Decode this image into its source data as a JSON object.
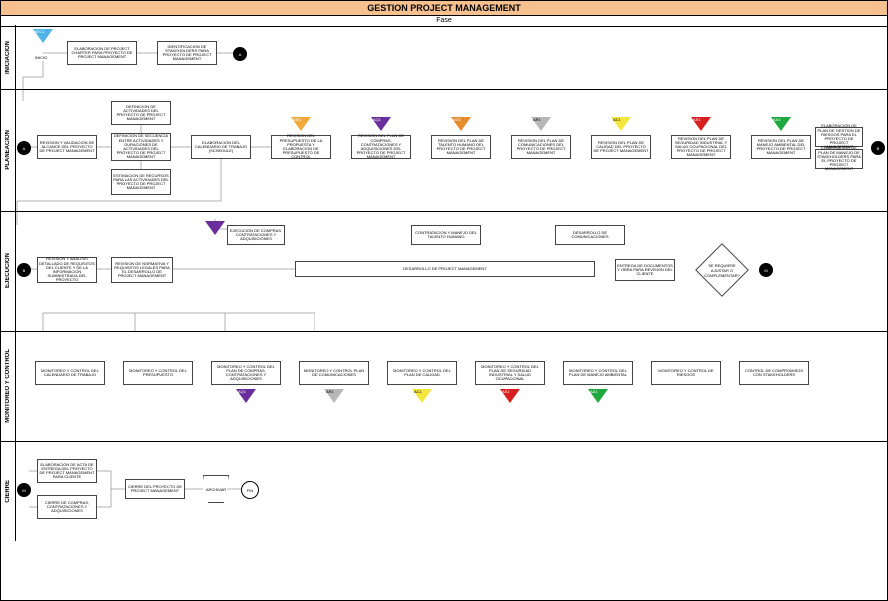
{
  "title": "GESTION PROJECT MANAGEMENT",
  "subtitle": "Fase",
  "lanes": {
    "iniciacion": "INICIACION",
    "planeacion": "PLANEACION",
    "ejecucion": "EJECUCION",
    "monitoreo": "MONITOREO Y CONTROL",
    "cierre": "CIERRE"
  },
  "nodes": {
    "inicio_label": "INICIO",
    "inicio_sig": "AEC1",
    "i1": "ELABORACION DE PROJECT CHARTER PARA PROYECTO DE PROJECT MANAGEMENT",
    "i2": "IDENTIFICACION DE STAKEHOLDERS PARA PROYECTO DE PROJECT MANAGEMENT",
    "ref_A": "A",
    "p1": "REVISION Y VALIDACION DE ALCANCE DEL PROYECTO DE PROJECT MANAGEMENT",
    "p2": "DEFINICION DE ACTIVIDADES DEL PROYECTO DE PROJECT MANAGEMENT",
    "p3": "DEFINICION DE SECUENCIA ENTRE ACTIVIDADES Y DURACIONES DE ACTIVIDADES DEL PROYECTO DE PROJECT MANAGEMENT",
    "p4": "ESTIMACION DE RECURSOS PARA LAS ACTIVIDADES DEL PROYECTO DE PROJECT MANAGEMENT",
    "p5": "ELABORACION DEL CALENDARIO DE TRABAJO (SCHEDULE)",
    "p6": "REVISION DEL PRESUPUESTO DE LA PROPUESTA Y ELABORACION DE PRESUPUESTO DE CONTROL",
    "p7": "REVISION DEL PLAN DE COMPRAS, CONTRATACIONES Y ADQUISICIONES DEL PROYECTO DE PROJECT MANAGEMENT",
    "p8": "REVISION DEL PLAN DE TALENTO HUMANO DEL PROYECTO DE PROJECT MANAGEMENT",
    "p9": "REVISION DEL PLAN DE COMUNICACIONES DEL PROYECTO DE PROJECT MANAGEMENT",
    "p10": "REVISION DEL PLAN DE CALIDAD DEL PROYECTO DE PROJECT MANAGEMENT",
    "p11": "REVISION DEL PLAN DE SEGURIDAD INDUSTRIAL Y SALUD OCUPACIONAL DEL PROYECTO DE PROJECT MANAGEMENT",
    "p12": "REVISION DEL PLAN DE MANEJO AMBIENTAL DEL PROYECTO DE PROJECT MANAGEMENT",
    "p13": "ELABORACION DE PLAN DE GESTION DE RIESGOS PARA EL PROYECTO DE PROJECT MANAGEMENT",
    "p14": "ELABORACION DE PLAN DE MANEJO DE STAKEHOLDERS PARA EL PROYECTO DE PROJECT MANAGEMENT",
    "sig_am": "AM1",
    "sig_vi": "AQ1",
    "sig_or": "AO1",
    "sig_gr": "AR1",
    "sig_ye": "AC1",
    "sig_re": "AS1",
    "sig_gn": "AA1",
    "e1": "REVISION Y ANALISIS DETALLADO DE REQUISITOS DEL CLIENTE Y DE LA INFORMACION SUMINISTRADA DEL PROYECTO",
    "e2": "REVISION DE NORMATIVA Y REQUISITOS LEGALES PARA EL DESARROLLO DE PROJECT MANAGEMENT",
    "e3": "EJECUCION DE COMPRAS, CONTRATACIONES Y ADQUISICIONES",
    "e4": "CONTRATACION Y MANEJO DEL TALENTO HUMANO",
    "e5": "DESARROLLO DE COMUNICACIONES",
    "e6": "DESARROLLO DE PROJECT MANAGEMENT",
    "e7": "ENTREGA DE DOCUMENTOS Y OBRA PARA REVISION DEL CLIENTE",
    "d1": "SE REQUIERE AJUSTAR O COMPLEMENTAR?",
    "m1": "MONITOREO Y CONTROL DEL CALENDARIO DE TRABAJO",
    "m2": "MONITOREO Y CONTROL DEL PRESUPUESTO",
    "m3": "MONITOREO Y CONTROL DEL PLAN DE COMPRAS, CONTRATACIONES Y ADQUISICIONES",
    "m4": "MONITOREO Y CONTROL PLAN DE COMUNICACIONES",
    "m5": "MONITOREO Y CONTROL DEL PLAN DE CALIDAD",
    "m6": "MONITOREO Y CONTROL DEL PLAN DE SEGURIDAD INDUSTRIAL Y SALUD OCUPACIONAL",
    "m7": "MONITOREO Y CONTROL DEL PLAN DE MANEJO AMBIENTAL",
    "m8": "MONITOREO Y CONTROL DE RIESGOS",
    "m9": "CONTROL DE COMPROMISOS CON STAKEHOLDERS",
    "sig_m_vi": "AQ1",
    "sig_m_gr": "AR1",
    "sig_m_ye": "AC1",
    "sig_m_re": "AS1",
    "sig_m_gn": "AA1",
    "c1": "ELABORACION DE ACTA DE ENTREGA DEL PROYECTO DE PROJECT MANAGEMENT PARA CLIENTE",
    "c2": "CIERRE DE COMPRAS, CONTRATACIONES Y ADQUISICIONES",
    "c3": "CIERRE DEL PROYECTO DE PROJECT MANAGEMENT",
    "c4": "ARCHIVAR",
    "fin": "FIN"
  },
  "colors": {
    "title_bg": "#f6c08f",
    "signal_blue": "#4fb3e6",
    "signal_amber": "#f2a93b",
    "signal_violet": "#6a2d9c",
    "signal_orange": "#e78c2e",
    "signal_gray": "#b7b7b7",
    "signal_yellow": "#f5e63d",
    "signal_red": "#d92020",
    "signal_green": "#1ea83d"
  }
}
